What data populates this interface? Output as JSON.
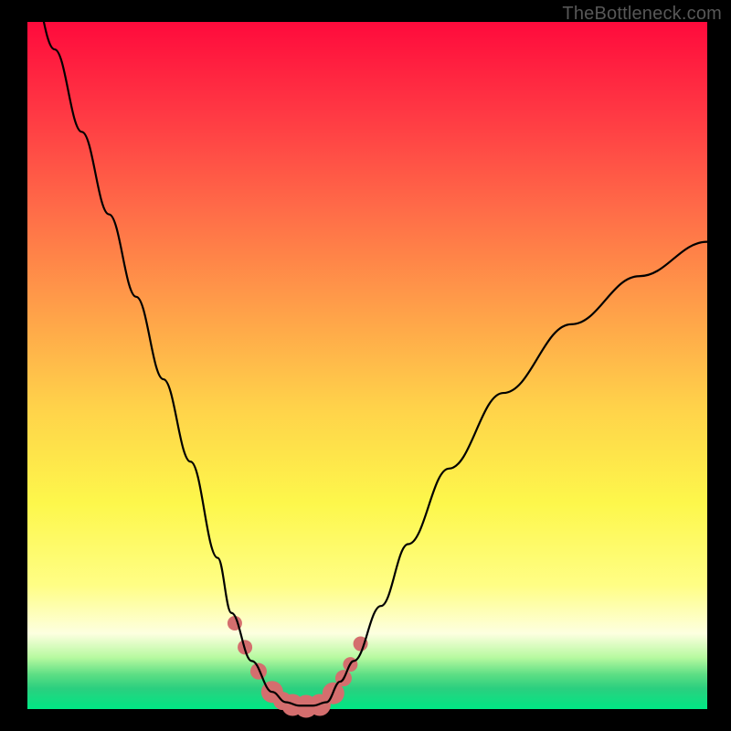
{
  "watermark": "TheBottleneck.com",
  "colors": {
    "frame": "#000000",
    "gradient_top": "#ff0a3c",
    "gradient_bottom": "#00e884",
    "curve": "#000000",
    "marker": "#d46e6e"
  },
  "chart_data": {
    "type": "line",
    "title": "",
    "xlabel": "",
    "ylabel": "",
    "xlim": [
      0,
      100
    ],
    "ylim": [
      0,
      100
    ],
    "series": [
      {
        "name": "bottleneck-curve",
        "x": [
          0,
          4,
          8,
          12,
          16,
          20,
          24,
          28,
          30,
          33,
          36,
          38,
          40,
          42,
          44,
          46,
          48,
          52,
          56,
          62,
          70,
          80,
          90,
          100
        ],
        "y": [
          108,
          96,
          84,
          72,
          60,
          48,
          36,
          22,
          14,
          7,
          2.5,
          1,
          0.5,
          0.5,
          1,
          4,
          7,
          15,
          24,
          35,
          46,
          56,
          63,
          68
        ]
      }
    ],
    "markers": {
      "name": "highlight-points",
      "x": [
        30.5,
        32.0,
        34.0,
        36.0,
        37.5,
        39.0,
        41.0,
        43.0,
        45.0,
        46.5,
        47.5,
        49.0
      ],
      "y": [
        12.5,
        9.0,
        5.5,
        2.5,
        1.2,
        0.6,
        0.4,
        0.6,
        2.3,
        4.5,
        6.5,
        9.5
      ],
      "radius": [
        8,
        8,
        9,
        12,
        10,
        12,
        12.5,
        12,
        12,
        9,
        8,
        8
      ]
    }
  }
}
